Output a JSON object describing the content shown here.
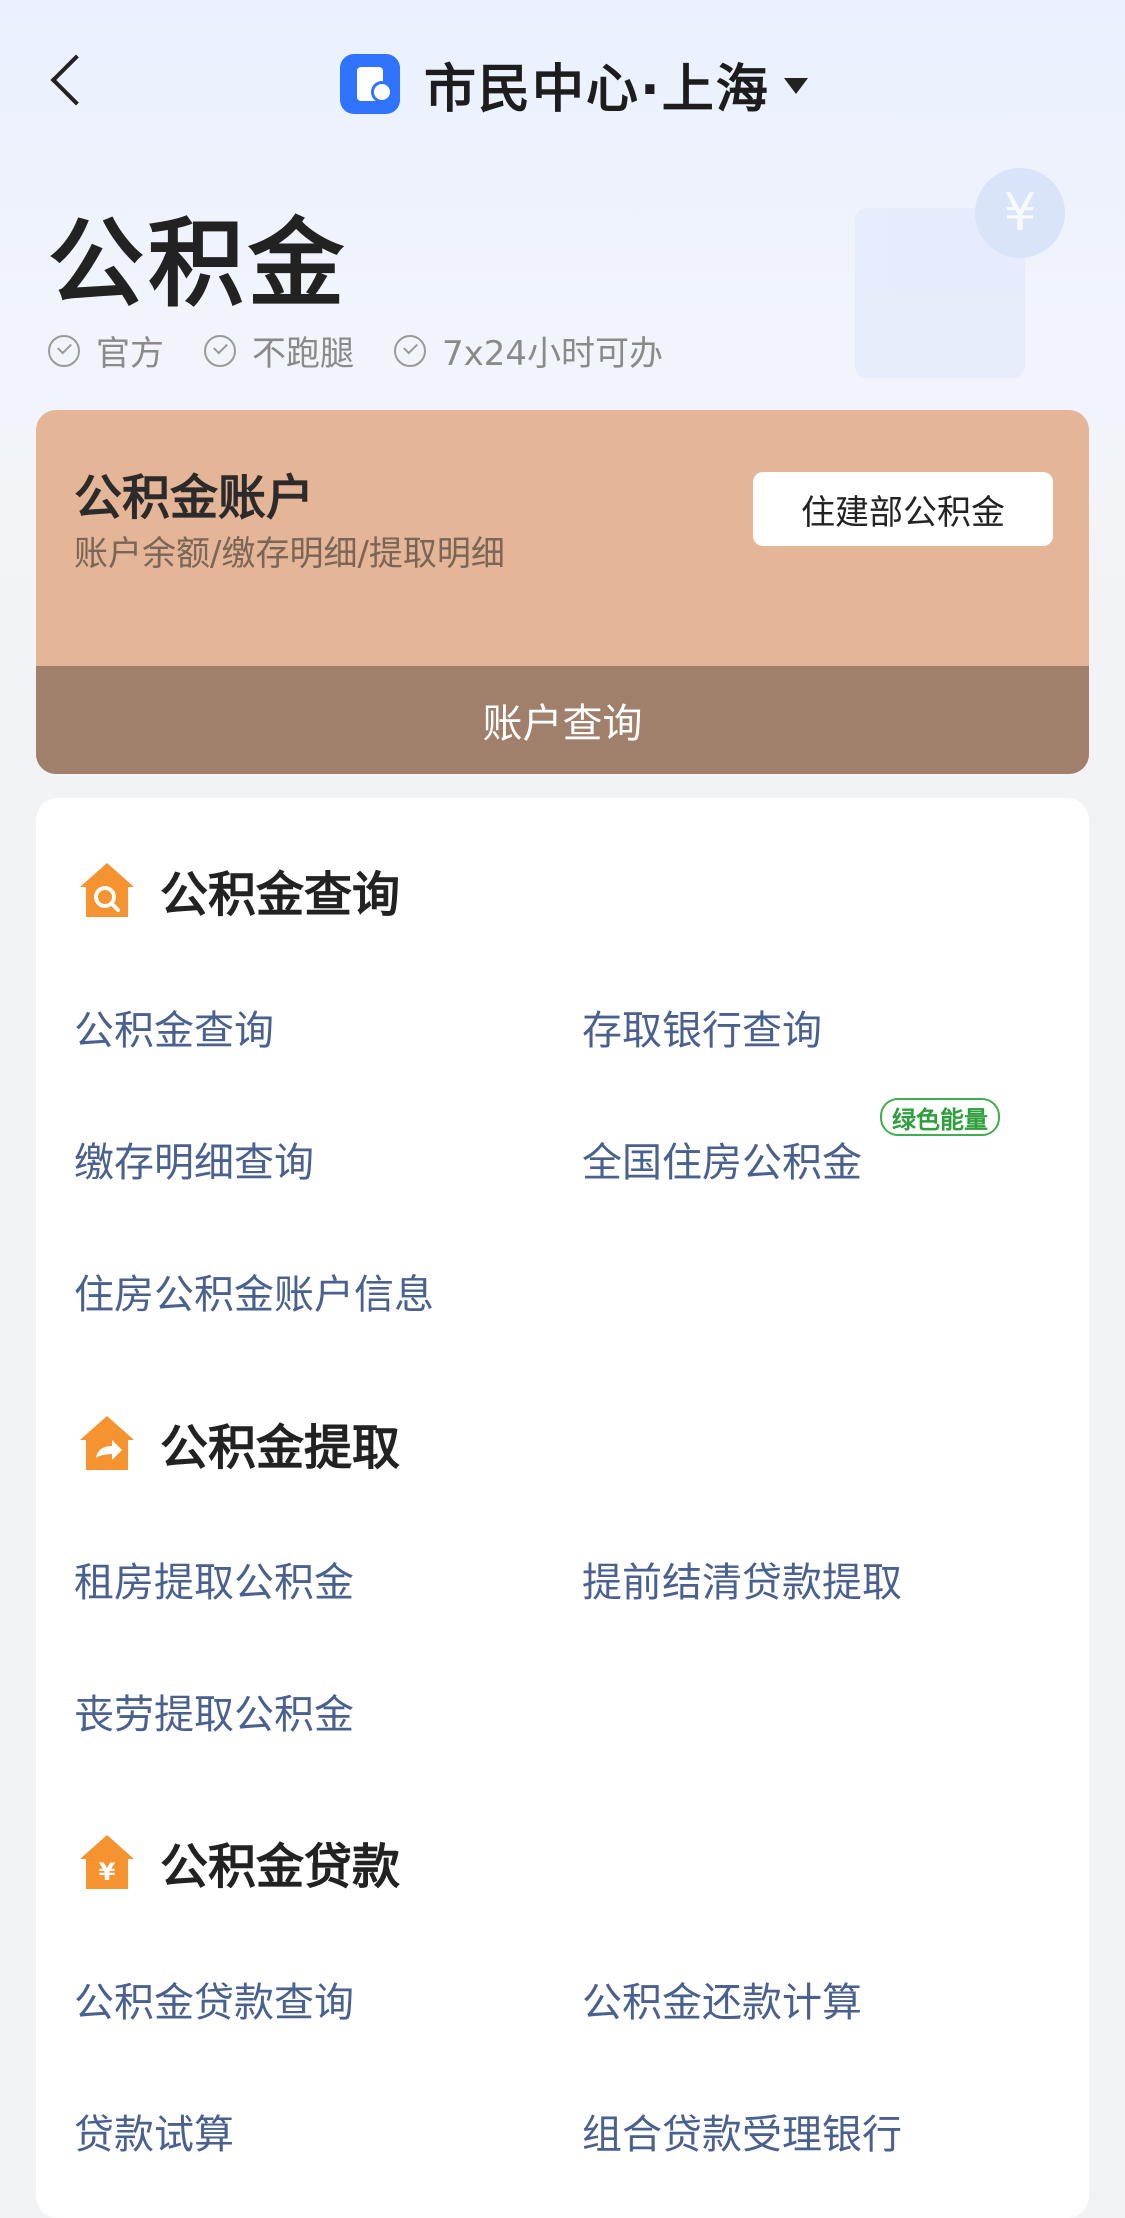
{
  "header": {
    "title": "市民中心·上海",
    "page_title": "公积金",
    "badges": [
      "官方",
      "不跑腿",
      "7x24小时可办"
    ]
  },
  "account": {
    "title": "公积金账户",
    "subtitle": "账户余额/缴存明细/提取明细",
    "button_label": "住建部公积金",
    "action_label": "账户查询"
  },
  "sections": [
    {
      "title": "公积金查询",
      "icon": "house-search-icon",
      "items": [
        "公积金查询",
        "存取银行查询",
        "缴存明细查询",
        "全国住房公积金",
        "住房公积金账户信息"
      ]
    },
    {
      "title": "公积金提取",
      "icon": "house-share-icon",
      "items": [
        "租房提取公积金",
        "提前结清贷款提取",
        "丧劳提取公积金"
      ]
    },
    {
      "title": "公积金贷款",
      "icon": "house-yen-icon",
      "items": [
        "公积金贷款查询",
        "公积金还款计算",
        "贷款试算",
        "组合贷款受理银行"
      ]
    }
  ],
  "tags": {
    "green_energy": "绿色能量"
  },
  "colors": {
    "accent": "#2f73ff",
    "card": "#e4b596",
    "card_bar": "#a07f6b",
    "link": "#4a6190",
    "section_icon": "#f59331",
    "tag_green": "#2f9e3d"
  }
}
